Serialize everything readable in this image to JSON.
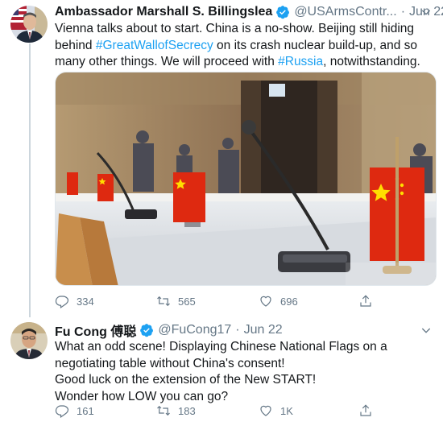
{
  "tweets": [
    {
      "name": "Ambassador Marshall S. Billingslea",
      "handle": "@USArmsContr...",
      "dot": "·",
      "date": "Jun 22",
      "text_parts": {
        "a": "Vienna talks about to start. China is a no-show. Beijing still hiding behind ",
        "tag1": "#GreatWallofSecrecy",
        "b": " on its crash nuclear build-up, and so many other things. We will proceed with ",
        "tag2": "#Russia",
        "c": ", notwithstanding."
      },
      "stats": {
        "replies": "334",
        "retweets": "565",
        "likes": "696"
      }
    },
    {
      "name": "Fu Cong 傅聪",
      "handle": "@FuCong17",
      "dot": "·",
      "date": "Jun 22",
      "lines": [
        "What an odd scene! Displaying Chinese National Flags on a negotiating table without China's consent!",
        "Good luck on the extension of the New START!",
        "Wonder how LOW you can go?"
      ],
      "stats": {
        "replies": "161",
        "retweets": "183",
        "likes": "1K"
      }
    }
  ],
  "icons": {
    "verified": "verified-badge-icon",
    "caret": "chevron-down-icon",
    "reply": "reply-icon",
    "retweet": "retweet-icon",
    "like": "heart-icon",
    "share": "share-icon"
  },
  "colors": {
    "link": "#1da1f2",
    "secondary_text": "#657786",
    "primary_text": "#14171a",
    "thread_line": "#ccd6dd",
    "flag_red": "#de2910",
    "flag_star": "#ffde00"
  }
}
